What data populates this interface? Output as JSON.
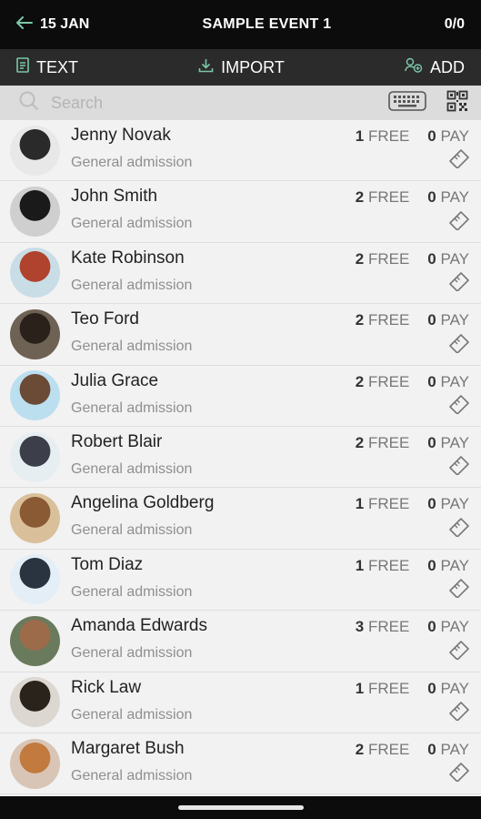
{
  "header": {
    "date": "15 JAN",
    "title": "SAMPLE EVENT 1",
    "count": "0/0"
  },
  "toolbar": {
    "text_label": "TEXT",
    "import_label": "IMPORT",
    "add_label": "ADD"
  },
  "search": {
    "placeholder": "Search",
    "value": ""
  },
  "free_label": "FREE",
  "pay_label": "PAY",
  "colors": {
    "topbar": "#0c0c0c",
    "toolbar": "#2b2b2b",
    "accent_icon": "#7bc7a8"
  },
  "attendees": [
    {
      "name": "Jenny Novak",
      "type": "General admission",
      "free": "1",
      "pay": "0",
      "avatar": [
        "#e8e8e8",
        "#2a2a2a"
      ]
    },
    {
      "name": "John Smith",
      "type": "General admission",
      "free": "2",
      "pay": "0",
      "avatar": [
        "#cfcfcf",
        "#1a1a1a"
      ]
    },
    {
      "name": "Kate Robinson",
      "type": "General admission",
      "free": "2",
      "pay": "0",
      "avatar": [
        "#c9dde6",
        "#b0432d"
      ]
    },
    {
      "name": "Teo Ford",
      "type": "General admission",
      "free": "2",
      "pay": "0",
      "avatar": [
        "#6e6254",
        "#2a211b"
      ]
    },
    {
      "name": "Julia Grace",
      "type": "General admission",
      "free": "2",
      "pay": "0",
      "avatar": [
        "#bcdff0",
        "#6b4a36"
      ]
    },
    {
      "name": "Robert Blair",
      "type": "General admission",
      "free": "2",
      "pay": "0",
      "avatar": [
        "#e6eef2",
        "#3c3f4a"
      ]
    },
    {
      "name": "Angelina Goldberg",
      "type": "General admission",
      "free": "1",
      "pay": "0",
      "avatar": [
        "#d9c09a",
        "#8a5a34"
      ]
    },
    {
      "name": "Tom Diaz",
      "type": "General admission",
      "free": "1",
      "pay": "0",
      "avatar": [
        "#e3eef6",
        "#2a3340"
      ]
    },
    {
      "name": "Amanda Edwards",
      "type": "General admission",
      "free": "3",
      "pay": "0",
      "avatar": [
        "#6a7a5c",
        "#9c6b4a"
      ]
    },
    {
      "name": "Rick Law",
      "type": "General admission",
      "free": "1",
      "pay": "0",
      "avatar": [
        "#dcd7d0",
        "#2a231c"
      ]
    },
    {
      "name": "Margaret Bush",
      "type": "General admission",
      "free": "2",
      "pay": "0",
      "avatar": [
        "#d8c5b5",
        "#c27a3e"
      ]
    }
  ]
}
